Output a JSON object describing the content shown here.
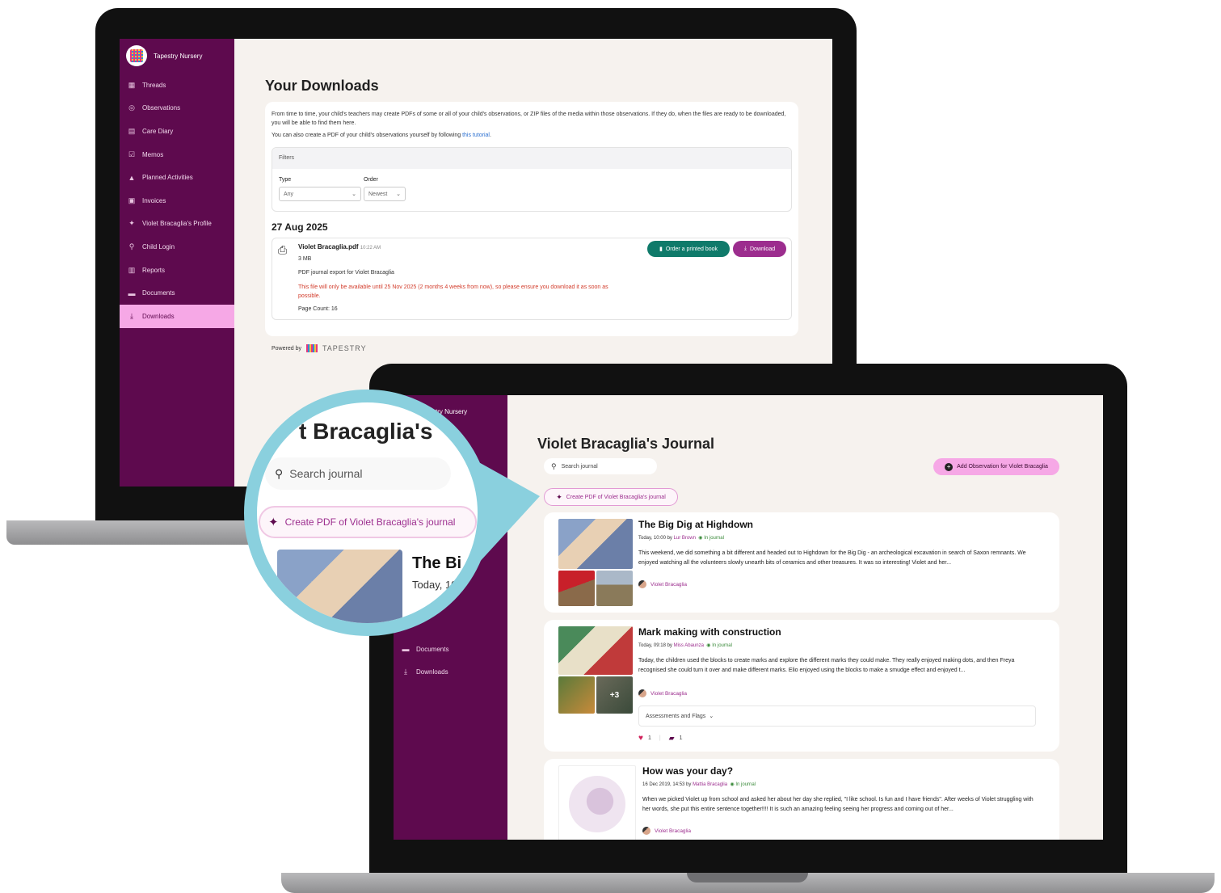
{
  "downloads_screen": {
    "brand": "Tapestry Nursery",
    "nav": [
      {
        "label": "Threads",
        "icon": "threads-icon",
        "glyph": "▦"
      },
      {
        "label": "Observations",
        "icon": "observations-icon",
        "glyph": "◎"
      },
      {
        "label": "Care Diary",
        "icon": "care-diary-icon",
        "glyph": "▤"
      },
      {
        "label": "Memos",
        "icon": "memos-icon",
        "glyph": "☑"
      },
      {
        "label": "Planned Activities",
        "icon": "planned-activities-icon",
        "glyph": "▲"
      },
      {
        "label": "Invoices",
        "icon": "invoices-icon",
        "glyph": "▣"
      },
      {
        "label": "Violet Bracaglia's Profile",
        "icon": "profile-icon",
        "glyph": "✦"
      },
      {
        "label": "Child Login",
        "icon": "child-login-icon",
        "glyph": "⚲"
      },
      {
        "label": "Reports",
        "icon": "reports-icon",
        "glyph": "▥"
      },
      {
        "label": "Documents",
        "icon": "documents-icon",
        "glyph": "▬"
      },
      {
        "label": "Downloads",
        "icon": "download-icon",
        "glyph": "⤓"
      }
    ],
    "title": "Your Downloads",
    "intro1": "From time to time, your child's teachers may create PDFs of some or all of your child's observations, or ZIP files of the media within those observations. If they do, when the files are ready to be downloaded, you will be able to find them here.",
    "intro2_prefix": "You can also create a PDF of your child's observations yourself by following ",
    "intro2_link": "this tutorial",
    "intro2_suffix": ".",
    "filters_label": "Filters",
    "type_label": "Type",
    "type_value": "Any",
    "order_label": "Order",
    "order_value": "Newest",
    "date_heading": "27 Aug 2025",
    "file": {
      "name": "Violet Bracaglia.pdf",
      "time": "10:22 AM",
      "size": "3 MB",
      "desc": "PDF journal export for Violet Bracaglia",
      "warning": "This file will only be available until 25 Nov 2025 (2 months 4 weeks from now), so please ensure you download it as soon as possible.",
      "page_count": "Page Count: 16"
    },
    "order_book_btn": "Order a printed book",
    "download_btn": "Download",
    "powered_by": "Powered by",
    "tapestry_word": "TAPESTRY"
  },
  "journal_screen": {
    "brand_partial": "stry Nursery",
    "nav_partial": [
      {
        "label": "Documents",
        "icon": "documents-icon",
        "glyph": "▬"
      },
      {
        "label": "Downloads",
        "icon": "download-icon",
        "glyph": "⤓"
      }
    ],
    "title": "Violet Bracaglia's Journal",
    "search_placeholder": "Search journal",
    "add_btn": "Add Observation for Violet Bracaglia",
    "create_pdf_btn": "Create PDF of Violet Bracaglia's journal",
    "observations": [
      {
        "title": "The Big Dig at Highdown",
        "when": "Today, 10:00 by",
        "author": "Lur Brown",
        "status": "In journal",
        "body": "This weekend, we did something a bit different and headed out to Highdown for the Big Dig - an archeological excavation in search of Saxon remnants. We enjoyed watching all the volunteers slowly unearth bits of ceramics and other treasures. It was so interesting! Violet and her...",
        "child": "Violet Bracaglia"
      },
      {
        "title": "Mark making with construction",
        "when": "Today, 09:18 by",
        "author": "Miss Abaunza",
        "status": "In journal",
        "body": "Today, the children used the blocks to create marks and explore the different marks they could make. They really enjoyed making dots, and then Freya recognised she could turn it over and make different marks. Elio enjoyed using the blocks to make a smudge effect and enjoyed t...",
        "child": "Violet Bracaglia",
        "assessments": "Assessments and Flags",
        "likes": "1",
        "comments": "1",
        "more_media": "+3"
      },
      {
        "title": "How was your day?",
        "when": "16 Dec 2019, 14:53 by",
        "author": "Mattia Bracaglia",
        "status": "In journal",
        "body": "When we picked Violet up from school and asked her about her day she replied, \"I like school. Is fun and I have friends\". After weeks of Violet struggling with her words, she put this entire sentence together!!!! It is such an amazing feeling seeing her progress and coming out of her...",
        "child": "Violet Bracaglia"
      }
    ]
  },
  "magnifier": {
    "heading_partial": "t Bracaglia's",
    "search_placeholder": "Search journal",
    "create_pdf_btn": "Create PDF of Violet Bracaglia's journal",
    "obs_title_partial": "The Bi",
    "obs_when_partial": "Today, 10"
  },
  "colors": {
    "sidebar": "#5e0a4e",
    "accent_pink": "#f6a8e6",
    "accent_purple": "#9c2d8e",
    "green": "#0f7a6a",
    "magnifier_ring": "#8ad0de"
  }
}
